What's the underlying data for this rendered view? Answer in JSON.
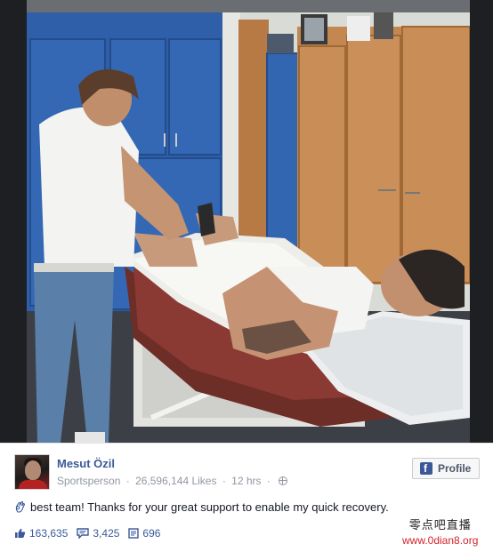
{
  "post": {
    "page_name": "Mesut Özil",
    "category": "Sportsperson",
    "likes": "26,596,144 Likes",
    "time": "12 hrs",
    "profile_button": "Profile",
    "message": "best team! Thanks for your great support to enable my quick recovery.",
    "icons": {
      "hand": "ok-hand-icon",
      "globe": "globe-icon",
      "facebook": "facebook-icon",
      "like": "thumbs-up-icon",
      "comment": "comment-icon",
      "share": "share-icon"
    },
    "stats": {
      "likes": "163,635",
      "comments": "3,425",
      "shares": "696"
    },
    "colors": {
      "link_blue": "#3b5998",
      "meta_gray": "#9197a3",
      "watermark_red": "#d2232a"
    }
  },
  "watermark": {
    "chinese": "零点吧直播",
    "url": "www.0dian8.org"
  }
}
